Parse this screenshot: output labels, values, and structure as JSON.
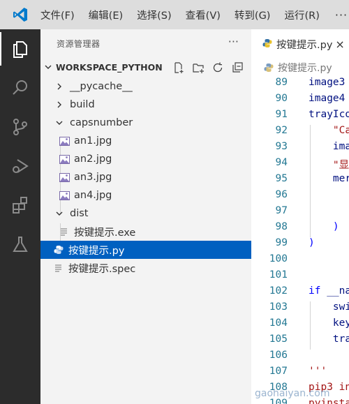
{
  "menu": [
    "文件(F)",
    "编辑(E)",
    "选择(S)",
    "查看(V)",
    "转到(G)",
    "运行(R)"
  ],
  "menu_more": "···",
  "activity_bar": [
    "explorer-icon",
    "search-icon",
    "source-control-icon",
    "run-debug-icon",
    "extensions-icon",
    "testing-icon"
  ],
  "explorer": {
    "title": "资源管理器",
    "more": "···",
    "workspace": "WORKSPACE_PYTHON",
    "items": [
      {
        "label": "__pycache__",
        "kind": "folder",
        "state": "collapsed"
      },
      {
        "label": "build",
        "kind": "folder",
        "state": "collapsed"
      },
      {
        "label": "capsnumber",
        "kind": "folder",
        "state": "expanded"
      },
      {
        "label": "an1.jpg",
        "kind": "image"
      },
      {
        "label": "an2.jpg",
        "kind": "image"
      },
      {
        "label": "an3.jpg",
        "kind": "image"
      },
      {
        "label": "an4.jpg",
        "kind": "image"
      },
      {
        "label": "dist",
        "kind": "folder",
        "state": "expanded"
      },
      {
        "label": "按键提示.exe",
        "kind": "exe"
      },
      {
        "label": "按键提示.py",
        "kind": "python",
        "selected": true
      },
      {
        "label": "按键提示.spec",
        "kind": "spec"
      }
    ]
  },
  "editor": {
    "tab_label": "按键提示.py",
    "tab_close": "×",
    "breadcrumb": "按键提示.py",
    "lines": [
      {
        "n": "89",
        "segments": [
          {
            "t": "image3",
            "c": "fn"
          }
        ]
      },
      {
        "n": "90",
        "segments": [
          {
            "t": "image4",
            "c": "fn"
          }
        ]
      },
      {
        "n": "91",
        "segments": [
          {
            "t": "trayIco",
            "c": "fn"
          }
        ]
      },
      {
        "n": "92",
        "segments": [
          {
            "t": "    ",
            "c": "plain"
          },
          {
            "t": "\"Ca",
            "c": "str"
          }
        ]
      },
      {
        "n": "93",
        "segments": [
          {
            "t": "    ",
            "c": "plain"
          },
          {
            "t": "ima",
            "c": "fn"
          }
        ]
      },
      {
        "n": "94",
        "segments": [
          {
            "t": "    ",
            "c": "plain"
          },
          {
            "t": "\"显",
            "c": "str"
          }
        ]
      },
      {
        "n": "95",
        "segments": [
          {
            "t": "    ",
            "c": "plain"
          },
          {
            "t": "mer",
            "c": "fn"
          }
        ]
      },
      {
        "n": "96",
        "segments": []
      },
      {
        "n": "97",
        "segments": []
      },
      {
        "n": "98",
        "segments": [
          {
            "t": "    ",
            "c": "plain"
          },
          {
            "t": ")",
            "c": "kw"
          }
        ]
      },
      {
        "n": "99",
        "segments": [
          {
            "t": ")",
            "c": "kw"
          }
        ]
      },
      {
        "n": "100",
        "segments": []
      },
      {
        "n": "101",
        "segments": []
      },
      {
        "n": "102",
        "segments": [
          {
            "t": "if",
            "c": "kw"
          },
          {
            "t": " __na",
            "c": "fn"
          }
        ]
      },
      {
        "n": "103",
        "segments": [
          {
            "t": "    ",
            "c": "plain"
          },
          {
            "t": "swi",
            "c": "fn"
          }
        ]
      },
      {
        "n": "104",
        "segments": [
          {
            "t": "    ",
            "c": "plain"
          },
          {
            "t": "key",
            "c": "fn"
          }
        ]
      },
      {
        "n": "105",
        "segments": [
          {
            "t": "    ",
            "c": "plain"
          },
          {
            "t": "tra",
            "c": "fn"
          }
        ]
      },
      {
        "n": "106",
        "segments": []
      },
      {
        "n": "107",
        "segments": [
          {
            "t": "'''",
            "c": "str"
          }
        ]
      },
      {
        "n": "108",
        "segments": [
          {
            "t": "pip3 in",
            "c": "str"
          }
        ]
      },
      {
        "n": "109",
        "segments": [
          {
            "t": "pyinsta",
            "c": "str"
          }
        ]
      }
    ]
  },
  "watermark": "gaohaiyan.com",
  "colors": {
    "selection": "#0060c0",
    "activity_bar": "#2c2c2c",
    "title_bar": "#dddddd",
    "sidebar": "#f3f3f3",
    "line_numbers": "#237893",
    "accent": "#007acc"
  }
}
